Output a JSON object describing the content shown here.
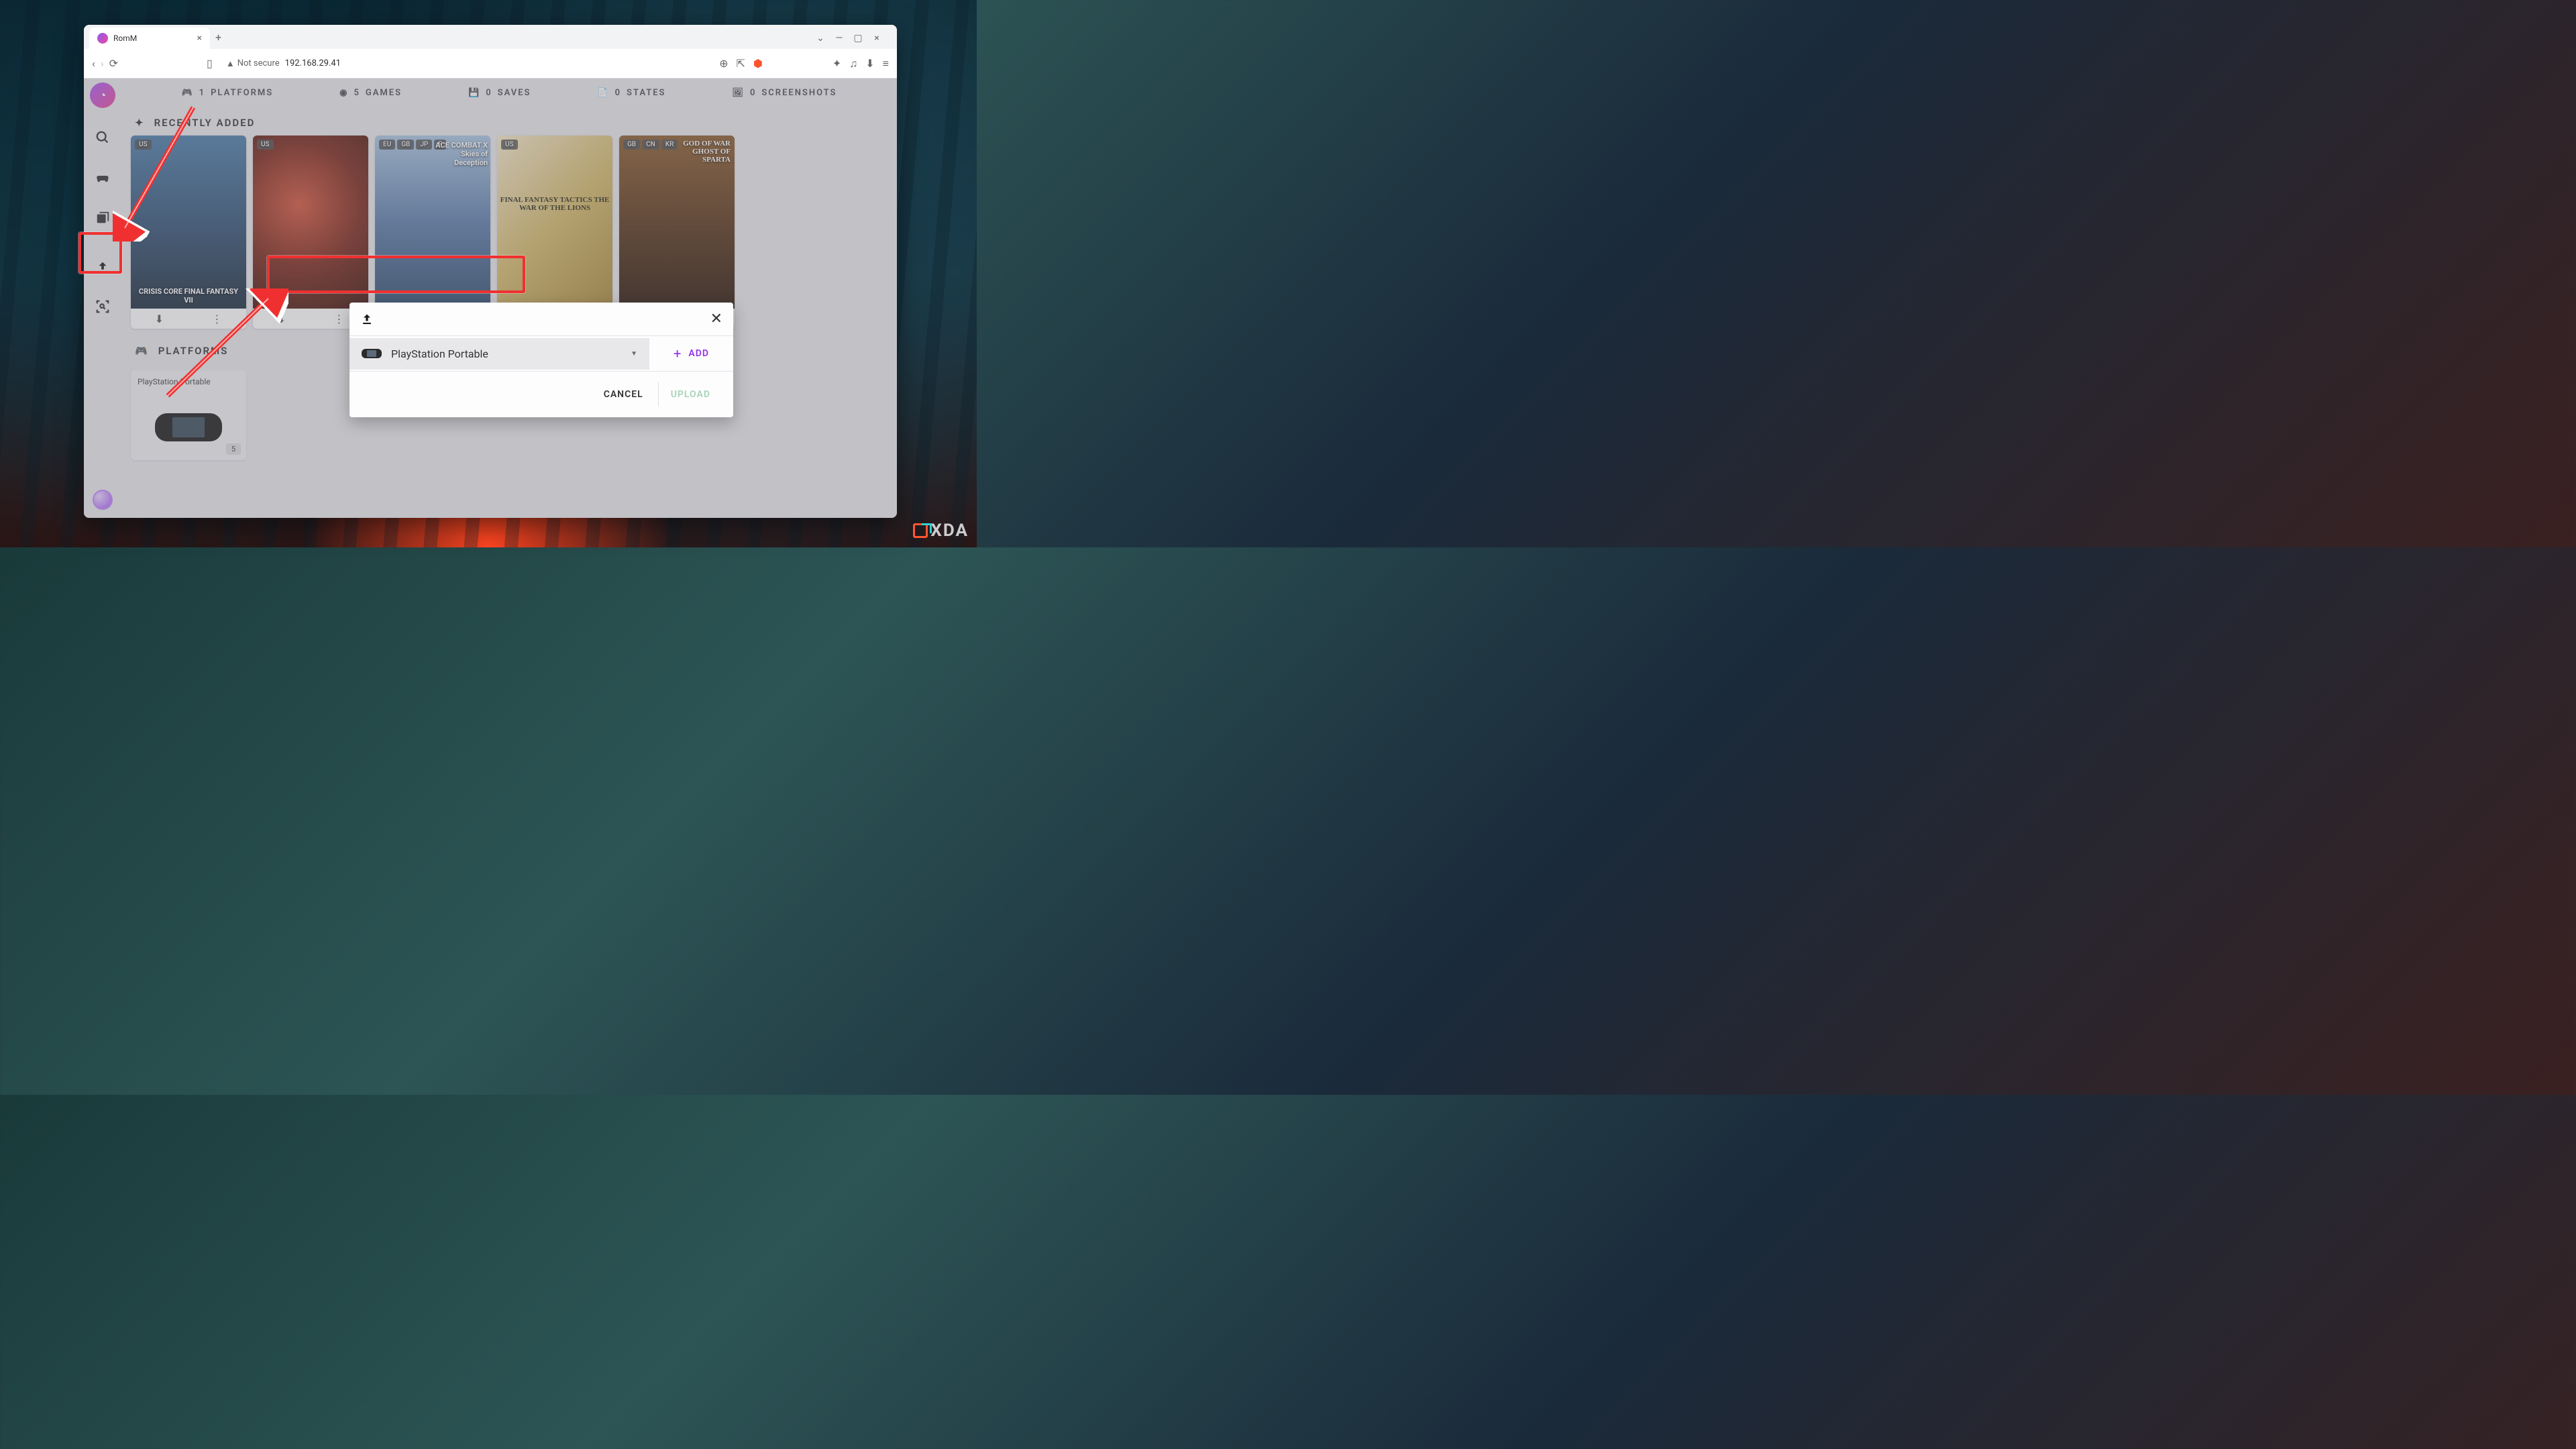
{
  "browser": {
    "tab_title": "RomM",
    "not_secure_label": "Not secure",
    "url": "192.168.29.41"
  },
  "stats": {
    "platforms": {
      "count": "1",
      "label": "PLATFORMS"
    },
    "games": {
      "count": "5",
      "label": "GAMES"
    },
    "saves": {
      "count": "0",
      "label": "SAVES"
    },
    "states": {
      "count": "0",
      "label": "STATES"
    },
    "screenshots": {
      "count": "0",
      "label": "SCREENSHOTS"
    }
  },
  "sections": {
    "recently_added": "RECENTLY ADDED",
    "platforms": "PLATFORMS"
  },
  "games": [
    {
      "regions": [
        "US"
      ],
      "title": "CRISIS CORE FINAL FANTASY VII"
    },
    {
      "regions": [
        "US"
      ],
      "title": ""
    },
    {
      "regions": [
        "EU",
        "GB",
        "JP",
        "F"
      ],
      "title": "ACE COMBAT X Skies of Deception"
    },
    {
      "regions": [
        "US"
      ],
      "title": "FINAL FANTASY TACTICS THE WAR OF THE LIONS"
    },
    {
      "regions": [
        "GB",
        "CN",
        "KR"
      ],
      "title": "GOD OF WAR GHOST OF SPARTA"
    }
  ],
  "platform_card": {
    "name": "PlayStation Portable",
    "count": "5"
  },
  "modal": {
    "selected_platform": "PlayStation Portable",
    "add_label": "ADD",
    "cancel_label": "CANCEL",
    "upload_label": "UPLOAD"
  },
  "watermark": "XDA"
}
